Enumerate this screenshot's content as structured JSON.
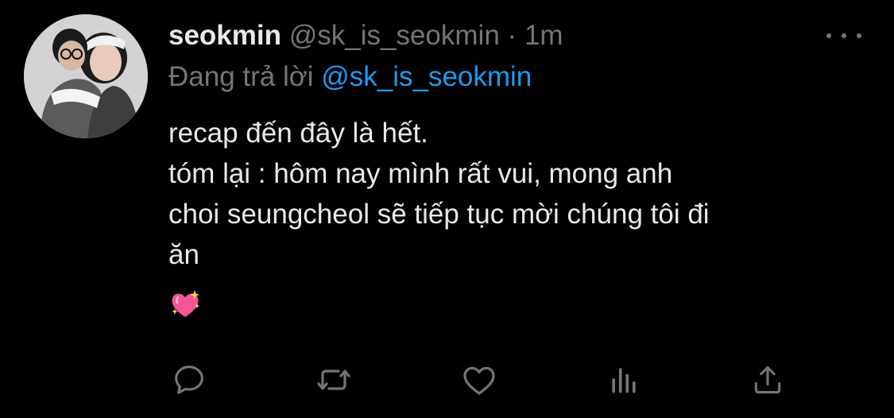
{
  "tweet": {
    "display_name": "seokmin",
    "handle": "@sk_is_seokmin",
    "separator": "·",
    "time": "1m",
    "reply_prefix": "Đang trả lời",
    "reply_handle": "@sk_is_seokmin",
    "text_lines": [
      "recap đến đây là hết.",
      "tóm lại : hôm nay mình rất vui, mong anh",
      "choi seungcheol sẽ tiếp tục mời chúng tôi đi",
      "ăn"
    ],
    "emoji": "sparkling-heart"
  },
  "actions": [
    {
      "name": "reply",
      "icon": "speech-bubble-icon"
    },
    {
      "name": "retweet",
      "icon": "retweet-arrows-icon"
    },
    {
      "name": "like",
      "icon": "heart-outline-icon"
    },
    {
      "name": "analytics",
      "icon": "bar-chart-icon"
    },
    {
      "name": "share",
      "icon": "share-upload-icon"
    }
  ],
  "colors": {
    "background": "#000000",
    "primary_text": "#e7e9ea",
    "secondary_text": "#71767b",
    "link": "#1d9bf0",
    "emoji_heart": "#f4559a"
  }
}
